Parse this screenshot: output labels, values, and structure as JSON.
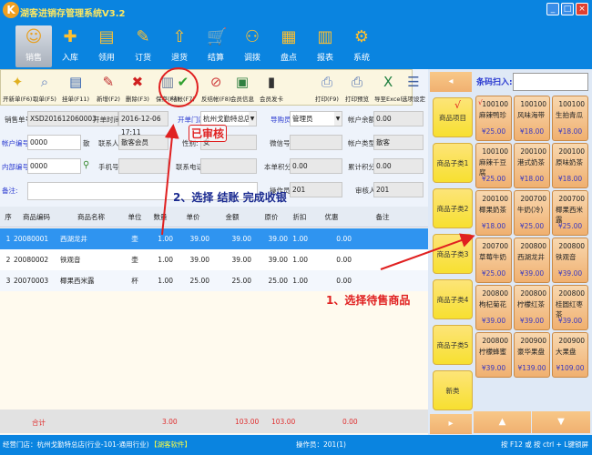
{
  "app": {
    "title": "湖客进销存管理系统V3.2",
    "logo": "K",
    "window_buttons": [
      "minimize",
      "maximize",
      "close"
    ]
  },
  "nav": [
    {
      "label": "销售",
      "icon": "sales-icon"
    },
    {
      "label": "入库",
      "icon": "stock-in-icon"
    },
    {
      "label": "领用",
      "icon": "requisition-icon"
    },
    {
      "label": "订货",
      "icon": "order-icon"
    },
    {
      "label": "退货",
      "icon": "return-icon"
    },
    {
      "label": "结算",
      "icon": "cart-icon"
    },
    {
      "label": "调拨",
      "icon": "transfer-icon"
    },
    {
      "label": "盘点",
      "icon": "inventory-icon"
    },
    {
      "label": "报表",
      "icon": "report-icon"
    },
    {
      "label": "系统",
      "icon": "gear-icon"
    }
  ],
  "toolbar": [
    {
      "label": "开新单(F6)"
    },
    {
      "label": "取单(F5)"
    },
    {
      "label": "挂单(F11)"
    },
    {
      "label": "新增(F2)"
    },
    {
      "label": "删除(F3)"
    },
    {
      "label": "保存(F4)"
    },
    {
      "label": "结帐(F7)"
    },
    {
      "label": "反结帐(F8)"
    },
    {
      "label": "会员信息"
    },
    {
      "label": "会员发卡"
    },
    {
      "label": "打印(F9)"
    },
    {
      "label": "打印预览"
    },
    {
      "label": "导至Excel"
    },
    {
      "label": "选项设定"
    }
  ],
  "form": {
    "order_no_label": "销售单号:",
    "order_no": "XSD201612060003",
    "open_time_label": "开单时间:",
    "open_time": "2016-12-06 17:11",
    "store_label": "开单门店:",
    "store": "杭州戈勤特总店",
    "guide_label": "导购员:",
    "guide": "管理员",
    "balance_label": "帐户余额:",
    "balance": "0.00",
    "account_label": "帐户编号:",
    "account": "0000",
    "account_suffix": "散",
    "contact_label": "联系人:",
    "contact": "散客会员",
    "gender_label": "性别:",
    "gender": "女",
    "wechat_label": "微信号:",
    "wechat": "",
    "acct_type_label": "帐户类型:",
    "acct_type": "散客",
    "internal_label": "内部编号:",
    "internal": "0000",
    "mobile_label": "手机号:",
    "mobile": "",
    "phone_label": "联系电话:",
    "phone": "",
    "points_label": "本单积分:",
    "points": "0.00",
    "total_points_label": "累计积分:",
    "total_points": "0.00",
    "remark_label": "备注:",
    "remark": "",
    "operator_label": "操作员:",
    "operator": "201",
    "auditor_label": "审核人:",
    "auditor": "201",
    "stamp": "已审核"
  },
  "table": {
    "headers": [
      "序",
      "商品编码",
      "商品名称",
      "单位",
      "数量",
      "单价",
      "金额",
      "原价",
      "折扣率",
      "优惠",
      "备注"
    ],
    "rows": [
      [
        "1",
        "20080001",
        "西湖龙井",
        "壶",
        "1.00",
        "39.00",
        "39.00",
        "39.00",
        "1.00",
        "0.00",
        ""
      ],
      [
        "2",
        "20080002",
        "铁观音",
        "壶",
        "1.00",
        "39.00",
        "39.00",
        "39.00",
        "1.00",
        "0.00",
        ""
      ],
      [
        "3",
        "20070003",
        "椰果西米露",
        "杯",
        "1.00",
        "25.00",
        "25.00",
        "25.00",
        "1.00",
        "0.00",
        ""
      ]
    ],
    "selected_row": 0,
    "total": {
      "label": "合计",
      "qty": "3.00",
      "amount": "103.00",
      "orig": "103.00",
      "discount": "0.00"
    }
  },
  "annotations": {
    "step2": "2、选择 结账 完成收银",
    "step1": "1、选择待售商品"
  },
  "right": {
    "barcode_label": "条码扫入:",
    "barcode": "",
    "categories": [
      {
        "label": "商品项目",
        "check": "√"
      },
      {
        "label": "商品子类1"
      },
      {
        "label": "商品子类2"
      },
      {
        "label": "商品子类3"
      },
      {
        "label": "商品子类4"
      },
      {
        "label": "商品子类5"
      },
      {
        "label": "新类"
      }
    ],
    "items": [
      {
        "code": "100100",
        "name": "麻辣鸭珍",
        "price": "¥25.00",
        "check": "√"
      },
      {
        "code": "100100",
        "name": "风味海带",
        "price": "¥18.00"
      },
      {
        "code": "100100",
        "name": "生拍青瓜",
        "price": "¥18.00"
      },
      {
        "code": "100100",
        "name": "麻辣千豆腐",
        "price": "¥25.00"
      },
      {
        "code": "200100",
        "name": "港式奶茶",
        "price": "¥18.00"
      },
      {
        "code": "200100",
        "name": "原味奶茶",
        "price": "¥18.00"
      },
      {
        "code": "200100",
        "name": "椰果奶茶",
        "price": "¥18.00"
      },
      {
        "code": "200700",
        "name": "牛奶(冷)",
        "price": "¥25.00"
      },
      {
        "code": "200700",
        "name": "椰果西米露",
        "price": "¥25.00"
      },
      {
        "code": "200700",
        "name": "草莓牛奶",
        "price": "¥25.00"
      },
      {
        "code": "200800",
        "name": "西湖龙井",
        "price": "¥39.00"
      },
      {
        "code": "200800",
        "name": "铁观音",
        "price": "¥39.00"
      },
      {
        "code": "200800",
        "name": "枸杞菊花",
        "price": "¥39.00"
      },
      {
        "code": "200800",
        "name": "柠檬红茶",
        "price": "¥39.00"
      },
      {
        "code": "200800",
        "name": "桂圆红枣茶",
        "price": "¥39.00"
      },
      {
        "code": "200800",
        "name": "柠檬蜂蜜",
        "price": "¥39.00"
      },
      {
        "code": "200900",
        "name": "豪华果盘",
        "price": "¥139.00"
      },
      {
        "code": "200900",
        "name": "大果盘",
        "price": "¥109.00"
      }
    ]
  },
  "status": {
    "store": "经营门店：杭州戈勤特总店(行业-101-通用行业)",
    "brand": "【湖客软件】",
    "operator": "操作员：201(1)",
    "hint": "按 F12 或 按 ctrl + L键锁屏"
  }
}
